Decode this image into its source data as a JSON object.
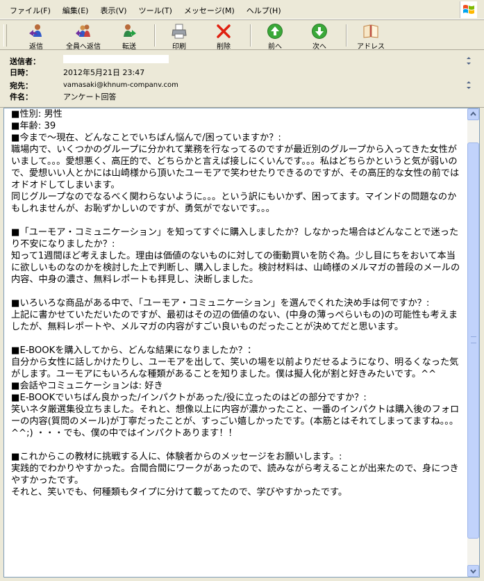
{
  "menubar": {
    "items": [
      "ファイル(F)",
      "編集(E)",
      "表示(V)",
      "ツール(T)",
      "メッセージ(M)",
      "ヘルプ(H)"
    ]
  },
  "toolbar": {
    "reply": "返信",
    "reply_all": "全員へ返信",
    "forward": "転送",
    "print": "印刷",
    "delete": "削除",
    "prev": "前へ",
    "next": "次へ",
    "address": "アドレス"
  },
  "header": {
    "from_label": "送信者：",
    "from_value": "",
    "date_label": "日時：",
    "date_value": "2012年5月21日 23:47",
    "to_label": "宛先：",
    "to_value": "vamasaki@khnum-companv.com",
    "subject_label": "件名：",
    "subject_value": "アンケート回答"
  },
  "message": {
    "lines": [
      "■性別: 男性",
      "■年齢: 39",
      "■今まで〜現在、どんなことでいちばん悩んで/困っていますか？:",
      "職場内で、いくつかのグループに分かれて業務を行なってるのですが最近別のグループから入ってきた女性がいまして。。。愛想悪く、高圧的で、どちらかと言えば接しにくいんです。。。私はどちらかというと気が弱いので、愛想いい人とかには山崎様から頂いたユーモアで笑わせたりできるのですが、その高圧的な女性の前ではオドオドしてしまいます。",
      "同じグループなのでなるべく関わらないように。。。という訳にもいかず、困ってます。マインドの問題なのかもしれませんが、お恥ずかしいのですが、勇気がでないです。。。",
      "",
      "■「ユーモア・コミュニケーション」を知ってすぐに購入しましたか？しなかった場合はどんなことで迷ったり不安になりましたか？:",
      "知って1週間ほど考えました。理由は価値のないものに対しての衝動買いを防ぐ為。少し目にちをおいて本当に欲しいものなのかを検討した上で判断し、購入しました。検討材料は、山崎様のメルマガの普段のメールの内容、中身の濃さ、無料レポートも拝見し、決断しました。",
      "",
      "■いろいろな商品がある中で、「ユーモア・コミュニケーション」を選んでくれた決め手は何ですか？:",
      "上記に書かせていただいたのですが、最初はその辺の価値のない、(中身の薄っぺらいもの)の可能性も考えましたが、無料レポートや、メルマガの内容がすごい良いものだったことが決めてだと思います。",
      "",
      "■E-BOOKを購入してから、どんな結果になりましたか？：",
      "自分から女性に話しかけたりし、ユーモアを出して、笑いの場を以前よりだせるようになり、明るくなった気がします。ユーモアにもいろんな種類があることを知りました。僕は擬人化が割と好きみたいです。^^",
      "■会話やコミュニケーションは: 好き",
      "■E-BOOKでいちばん良かった/インパクトがあった/役に立ったのはどの部分ですか？:",
      "笑いネタ厳選集役立ちました。それと、想像以上に内容が濃かったこと、一番のインパクトは購入後のフォローの内容(質問のメール)が丁寧だったことが、すっごい嬉しかったです。(本筋とはそれてしまってますね。。。^^;) ・・・でも、僕の中ではインパクトあります！！",
      "",
      "■これからこの教材に挑戦する人に、体験者からのメッセージをお願いします。:",
      "実践的でわかりやすかった。合間合間にワークがあったので、読みながら考えることが出来たので、身につきやすかったです。",
      "それと、笑いでも、何種類もタイプに分けて載ってたので、学びやすかったです。"
    ]
  },
  "colors": {
    "chrome": "#ece9d8",
    "delete_red": "#e02010",
    "nav_green": "#3aa838",
    "scrollbar": "#c1d3fb"
  },
  "icons": [
    "reply-icon",
    "reply-all-icon",
    "forward-icon",
    "print-icon",
    "delete-icon",
    "prev-icon",
    "next-icon",
    "address-book-icon",
    "windows-logo-icon"
  ]
}
